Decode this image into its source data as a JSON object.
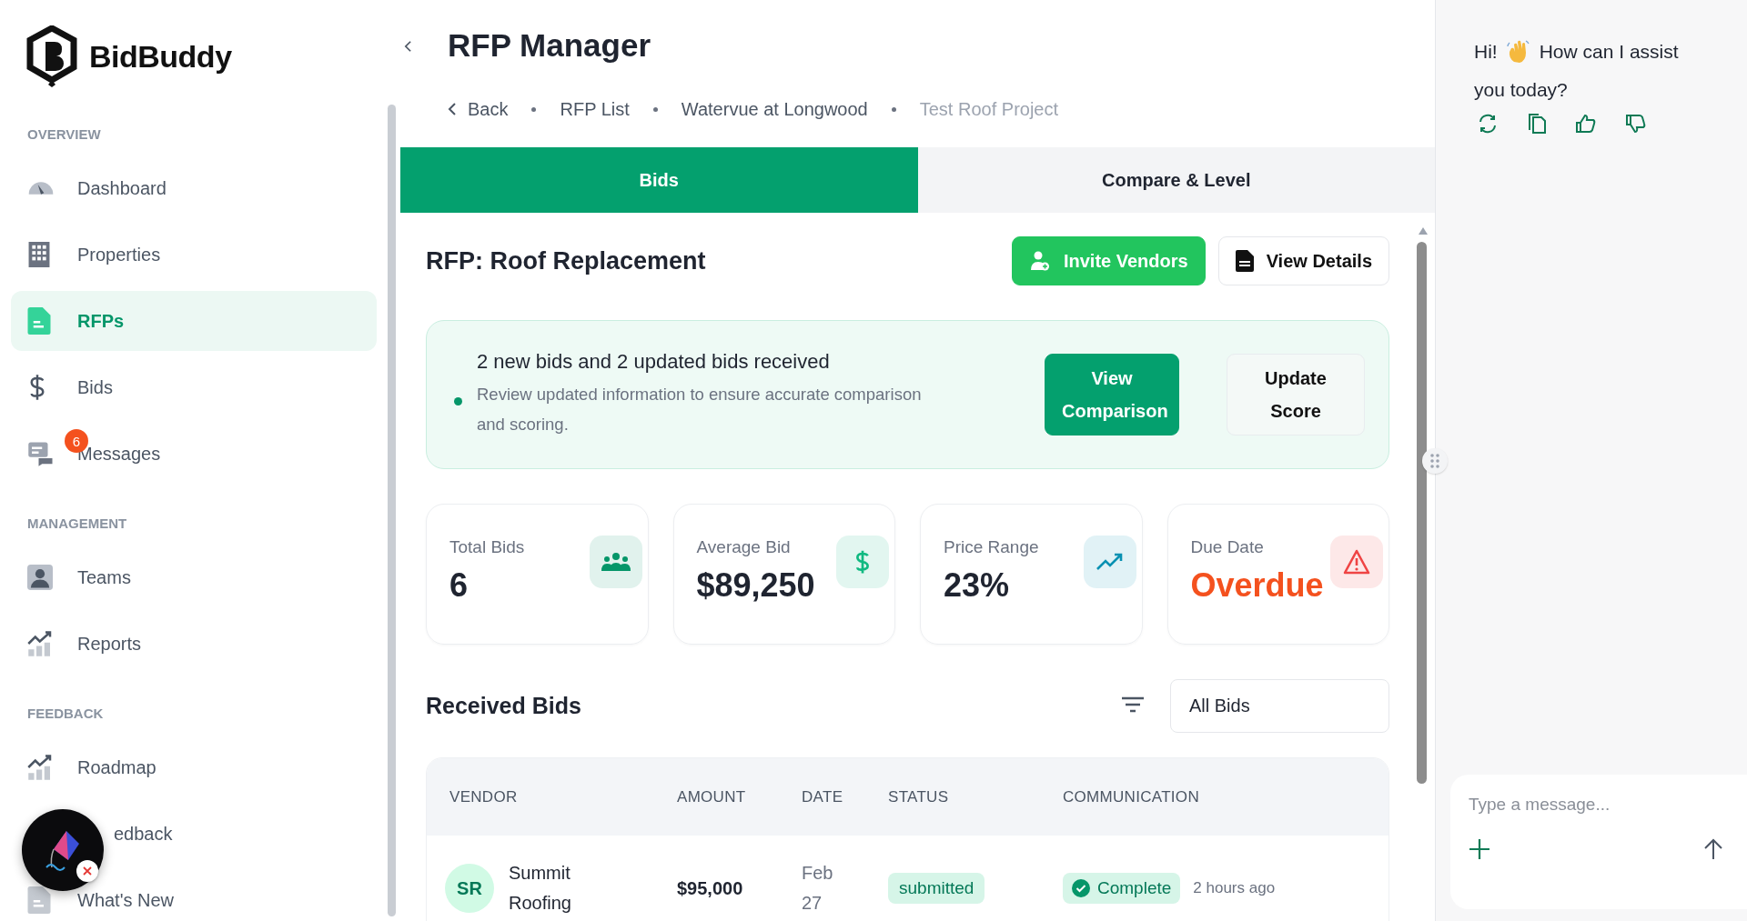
{
  "app": {
    "name": "BidBuddy"
  },
  "sidebar": {
    "sections": [
      {
        "title": "OVERVIEW",
        "items": [
          {
            "label": "Dashboard",
            "selected": false
          },
          {
            "label": "Properties",
            "selected": false
          },
          {
            "label": "RFPs",
            "selected": true
          },
          {
            "label": "Bids",
            "selected": false
          },
          {
            "label": "Messages",
            "selected": false,
            "badge": "6"
          }
        ]
      },
      {
        "title": "MANAGEMENT",
        "items": [
          {
            "label": "Teams",
            "selected": false
          },
          {
            "label": "Reports",
            "selected": false
          }
        ]
      },
      {
        "title": "FEEDBACK",
        "items": [
          {
            "label": "Roadmap",
            "selected": false
          },
          {
            "label": "edback",
            "selected": false
          },
          {
            "label": "What's New",
            "selected": false
          }
        ]
      }
    ]
  },
  "page_title": "RFP Manager",
  "breadcrumb": [
    {
      "label": "Back",
      "kind": "back",
      "current": false
    },
    {
      "label": "RFP List",
      "kind": "link",
      "current": false
    },
    {
      "label": "Watervue at Longwood",
      "kind": "link",
      "current": false
    },
    {
      "label": "Test Roof Project",
      "kind": "link",
      "current": true
    }
  ],
  "tabs": [
    {
      "label": "Bids",
      "selected": true
    },
    {
      "label": "Compare & Level",
      "selected": false
    }
  ],
  "rfp": {
    "title": "RFP: Roof Replacement",
    "actions": [
      {
        "label": "Invite Vendors",
        "primary": true
      },
      {
        "label": "View Details",
        "primary": false
      }
    ]
  },
  "alert": {
    "title": "2 new bids and 2 updated bids received",
    "message": "Review updated information to ensure accurate comparison and scoring.",
    "actions": [
      {
        "label": "View Comparison",
        "primary": true
      },
      {
        "label": "Update Score",
        "primary": false
      }
    ]
  },
  "stats": [
    {
      "label": "Total Bids",
      "value": "6",
      "color": "#059669",
      "warning": false
    },
    {
      "label": "Average Bid",
      "value": "$89,250",
      "color": "#10b981",
      "warning": false
    },
    {
      "label": "Price Range",
      "value": "23%",
      "color": "#0891b2",
      "warning": false
    },
    {
      "label": "Due Date",
      "value": "Overdue",
      "color": "#ef4444",
      "warning": true
    }
  ],
  "received_bids": {
    "title": "Received Bids",
    "filter": {
      "value": "All Bids"
    },
    "columns": [
      "VENDOR",
      "AMOUNT",
      "DATE",
      "STATUS",
      "COMMUNICATION"
    ],
    "rows": [
      {
        "initials": "SR",
        "vendor": "Summit Roofing",
        "amount": "$95,000",
        "date": "Feb 27",
        "status": "submitted",
        "communication": "Complete",
        "updated": "2 hours ago"
      }
    ]
  },
  "chat": {
    "greeting": [
      "Hi!",
      "How can I assist",
      "you today?"
    ],
    "input": {
      "placeholder": "Type a message..."
    }
  }
}
